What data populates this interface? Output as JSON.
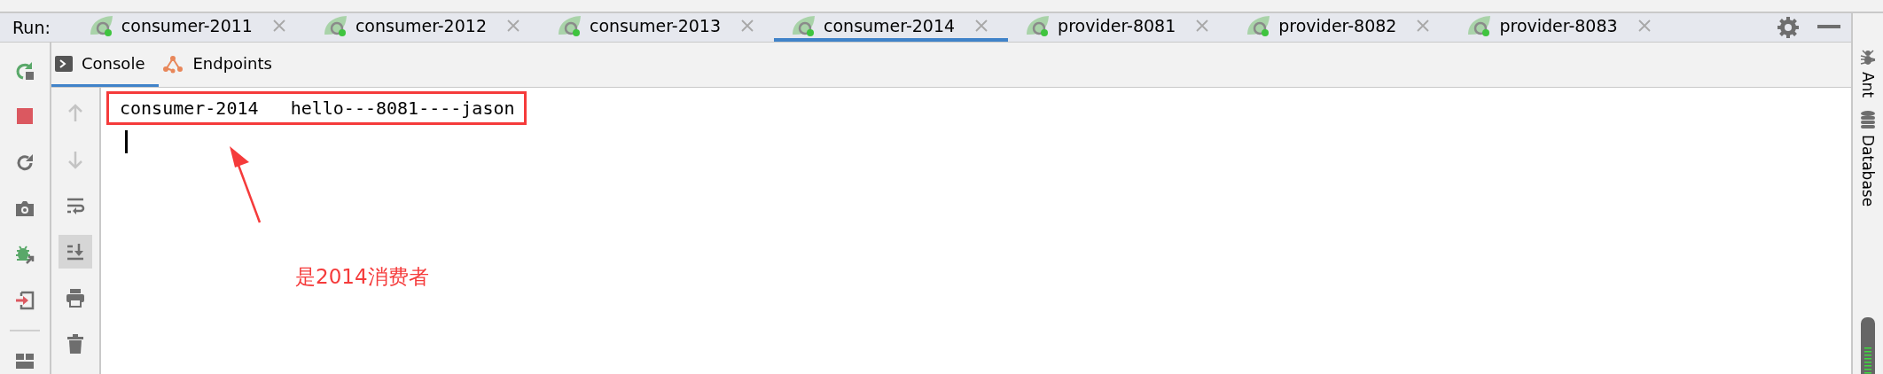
{
  "run_label": "Run:",
  "tabs": [
    {
      "label": "consumer-2011",
      "selected": false
    },
    {
      "label": "consumer-2012",
      "selected": false
    },
    {
      "label": "consumer-2013",
      "selected": false
    },
    {
      "label": "consumer-2014",
      "selected": true
    },
    {
      "label": "provider-8081",
      "selected": false
    },
    {
      "label": "provider-8082",
      "selected": false
    },
    {
      "label": "provider-8083",
      "selected": false
    }
  ],
  "run_toolbar": [
    {
      "kind": "rerun"
    },
    {
      "kind": "stop"
    },
    {
      "kind": "restart"
    },
    {
      "kind": "camera"
    },
    {
      "kind": "debug"
    },
    {
      "kind": "exit"
    },
    {
      "kind": "separator"
    },
    {
      "kind": "layout"
    }
  ],
  "sub_tabs": [
    {
      "kind": "console",
      "label": "Console",
      "selected": true
    },
    {
      "kind": "endpoints",
      "label": "Endpoints",
      "selected": false
    }
  ],
  "console_toolbar": [
    {
      "kind": "up",
      "disabled": true,
      "selected": false
    },
    {
      "kind": "down",
      "disabled": true,
      "selected": false
    },
    {
      "kind": "wrap",
      "disabled": false,
      "selected": false
    },
    {
      "kind": "scroll-end",
      "disabled": false,
      "selected": true
    },
    {
      "kind": "print",
      "disabled": false,
      "selected": false
    },
    {
      "kind": "trash",
      "disabled": false,
      "selected": false
    }
  ],
  "console_lines": [
    "consumer-2014   hello---8081----jason"
  ],
  "annotation": "是2014消费者",
  "side_tools": [
    {
      "kind": "ant",
      "label": "Ant"
    },
    {
      "kind": "database",
      "label": "Database"
    }
  ]
}
